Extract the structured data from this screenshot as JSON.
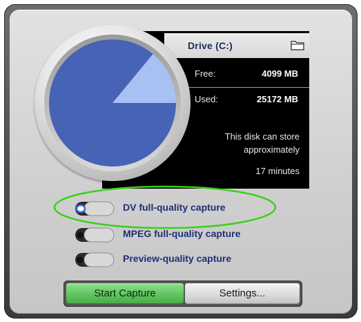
{
  "drive": {
    "label": "Drive (C:)",
    "free_label": "Free:",
    "free_value": "4099 MB",
    "used_label": "Used:",
    "used_value": "25172 MB",
    "free_fraction": 0.14
  },
  "estimate": {
    "line1": "This disk can store",
    "line2": "approximately",
    "line3": "17 minutes"
  },
  "capture_options": [
    {
      "label": "DV full-quality capture",
      "selected": true
    },
    {
      "label": "MPEG full-quality capture",
      "selected": false
    },
    {
      "label": "Preview-quality capture",
      "selected": false
    }
  ],
  "buttons": {
    "start_label": "Start Capture",
    "settings_label": "Settings..."
  },
  "colors": {
    "used_slice": "#4763b6",
    "free_slice": "#a8c1f2",
    "highlight": "#39d11a",
    "start_button": "#5fc35f"
  },
  "icons": {
    "folder": "folder-icon"
  }
}
